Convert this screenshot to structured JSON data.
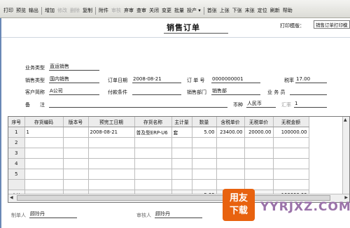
{
  "toolbar": {
    "items": [
      {
        "label": "打印",
        "enabled": true
      },
      {
        "label": "预览",
        "enabled": true
      },
      {
        "label": "输出",
        "enabled": true
      },
      {
        "label": "增加",
        "enabled": true
      },
      {
        "label": "修改",
        "enabled": false
      },
      {
        "label": "删除",
        "enabled": false
      },
      {
        "label": "复制",
        "enabled": true
      },
      {
        "label": "附件",
        "enabled": true
      },
      {
        "label": "审核",
        "enabled": false
      },
      {
        "label": "弃审",
        "enabled": true
      },
      {
        "label": "查审",
        "enabled": true
      },
      {
        "label": "关闭",
        "enabled": true
      },
      {
        "label": "变更",
        "enabled": true
      },
      {
        "label": "批量",
        "enabled": true
      },
      {
        "label": "投产 ▾",
        "enabled": true
      },
      {
        "label": "首张",
        "enabled": true
      },
      {
        "label": "上张",
        "enabled": true
      },
      {
        "label": "下张",
        "enabled": true
      },
      {
        "label": "末张",
        "enabled": true
      },
      {
        "label": "定位",
        "enabled": true
      },
      {
        "label": "刷新",
        "enabled": true
      },
      {
        "label": "帮助",
        "enabled": true
      }
    ]
  },
  "form": {
    "title": "销售订单",
    "print_template_label": "打印模版：",
    "print_template_value": "销售订单打印模",
    "business_type_label": "业务类型",
    "business_type_value": "直运销售",
    "sales_type_label": "销售类型",
    "sales_type_value": "国内销售",
    "order_date_label": "订单日期",
    "order_date_value": "2008-08-21",
    "order_no_label": "订 单 号",
    "order_no_value": "0000000001",
    "tax_rate_label": "税率",
    "tax_rate_value": "17.00",
    "customer_label": "客户简称",
    "customer_value": "A公司",
    "payment_label": "付款条件",
    "payment_value": "",
    "dept_label": "销售部门",
    "dept_value": "销售部",
    "salesman_label": "业 务 员",
    "salesman_value": "",
    "remark_label": "备　　注",
    "remark_value": "",
    "currency_label": "币种",
    "currency_value": "人民币",
    "exchange_label": "汇率",
    "exchange_value": "1"
  },
  "grid": {
    "headers": [
      "序号",
      "存货编码",
      "版本号",
      "预完工日期",
      "存货名称",
      "主计量",
      "数量",
      "含税单价",
      "无税单价",
      "无税金额"
    ],
    "rows": [
      [
        "1",
        "1",
        "",
        "2008-08-21",
        "普及型ERP-U6",
        "套",
        "5.00",
        "23400.00",
        "20000.00",
        "100000.00"
      ],
      [
        "2",
        "",
        "",
        "",
        "",
        "",
        "",
        "",
        "",
        ""
      ],
      [
        "3",
        "",
        "",
        "",
        "",
        "",
        "",
        "",
        "",
        ""
      ],
      [
        "4",
        "",
        "",
        "",
        "",
        "",
        "",
        "",
        "",
        ""
      ],
      [
        "5",
        "",
        "",
        "",
        "",
        "",
        "",
        "",
        "",
        ""
      ]
    ],
    "total_label": "合计",
    "total_qty": "5.00",
    "total_amount": "100000.00"
  },
  "footer": {
    "maker_label": "制单人",
    "maker_value": "顾玲丹",
    "auditor_label": "审核人",
    "auditor_value": "顾玲丹"
  },
  "watermark": {
    "badge_line1": "用友",
    "badge_line2": "下载",
    "site": "YYRJXZ.COM"
  }
}
